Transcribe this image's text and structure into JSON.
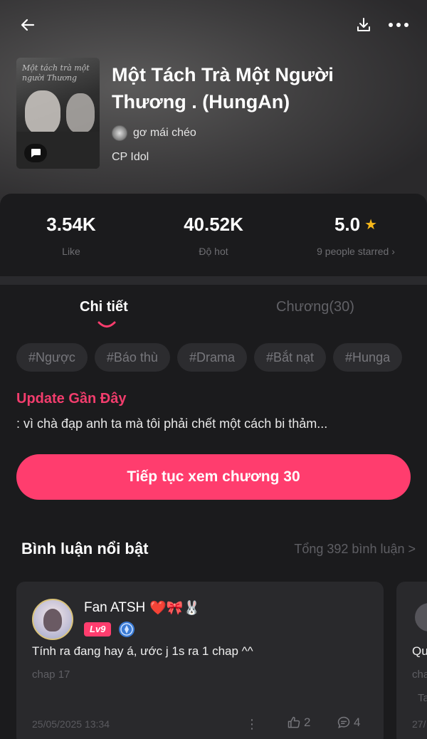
{
  "story": {
    "title": "Một Tách Trà Một Người Thương . (HungAn)",
    "cover_text": "Một tách trà một người Thương",
    "author": "gơ mái chéo",
    "genre": "CP Idol"
  },
  "stats": [
    {
      "value": "3.54K",
      "label": "Like"
    },
    {
      "value": "40.52K",
      "label": "Độ hot"
    },
    {
      "value": "5.0",
      "label": "9 people starred  ›"
    }
  ],
  "tabs": {
    "details": "Chi tiết",
    "chapters": "Chương(30)"
  },
  "tags": [
    "#Ngược",
    "#Báo thù",
    "#Drama",
    "#Bắt nạt",
    "#Hunga"
  ],
  "update": {
    "title": "Update Gần Đây",
    "text": ": vì chà đạp anh ta mà tôi phải chết một cách bi thảm..."
  },
  "cta": {
    "label": "Tiếp tục xem chương 30"
  },
  "comments_section": {
    "title": "Bình luận nổi bật",
    "total": "Tổng 392 bình luận >"
  },
  "comments": [
    {
      "user": "Fan ATSH",
      "emoji": "❤️🎀🐰",
      "level": "Lv9",
      "text": "Tính ra đang hay á, ước j 1s ra 1 chap ^^",
      "chapter": "chap 17",
      "date": "25/05/2025 13:34",
      "likes": "2",
      "replies": "4"
    },
    {
      "text": "Qu",
      "chapter": "cha",
      "extra": "Ta",
      "date": "27/"
    }
  ],
  "icons": {
    "back": "back-arrow-icon",
    "download": "download-icon",
    "more": "more-dots-icon",
    "star": "star-icon",
    "like": "thumbs-up-icon",
    "reply": "comment-bubble-icon"
  },
  "colors": {
    "accent": "#ff3d6e",
    "update_title": "#f23d6d",
    "star": "#f7b81a"
  }
}
